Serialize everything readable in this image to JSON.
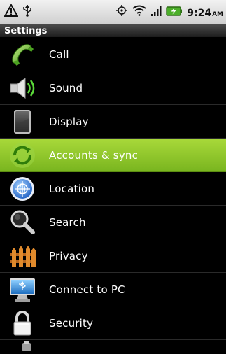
{
  "status_bar": {
    "time": "9:24",
    "ampm": "AM",
    "icons": [
      "warning-icon",
      "usb-icon",
      "gps-icon",
      "wifi-icon",
      "signal-icon",
      "battery-icon"
    ]
  },
  "app_bar": {
    "title": "Settings"
  },
  "settings": {
    "items": [
      {
        "label": "Call",
        "icon": "phone-icon"
      },
      {
        "label": "Sound",
        "icon": "speaker-icon"
      },
      {
        "label": "Display",
        "icon": "display-icon"
      },
      {
        "label": "Accounts & sync",
        "icon": "sync-icon",
        "selected": true
      },
      {
        "label": "Location",
        "icon": "location-globe-icon"
      },
      {
        "label": "Search",
        "icon": "magnifier-icon"
      },
      {
        "label": "Privacy",
        "icon": "fence-icon"
      },
      {
        "label": "Connect to PC",
        "icon": "usb-monitor-icon"
      },
      {
        "label": "Security",
        "icon": "lock-icon"
      }
    ]
  },
  "colors": {
    "selected_start": "#a9d93a",
    "selected_end": "#79b51f",
    "statusbar": "#e6e6e6"
  }
}
